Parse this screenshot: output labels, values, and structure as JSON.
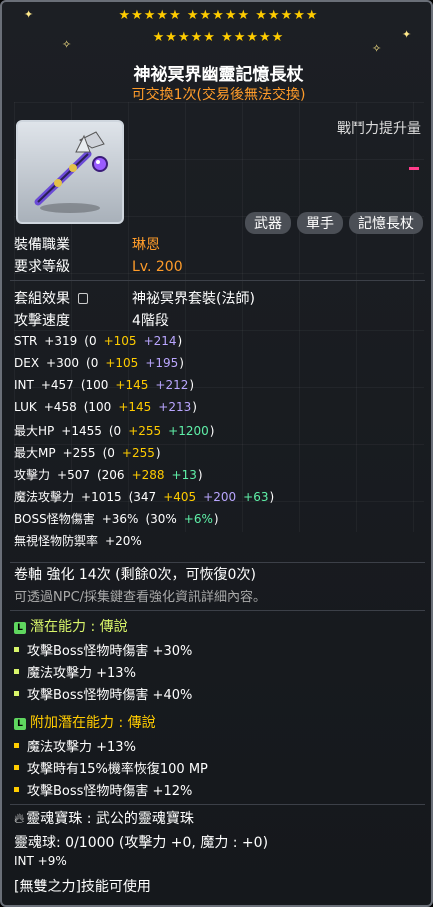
{
  "header": {
    "stars_row1": "★★★★★  ★★★★★  ★★★★★",
    "stars_row2": "★★★★★  ★★★★★",
    "title": "神祕冥界幽靈記憶長杖",
    "trade_note": "可交換1次(交易後無法交換)"
  },
  "item": {
    "icon": "staff-icon",
    "combat_power_label": "戰鬥力提升量",
    "tags": [
      "武器",
      "單手",
      "記憶長杖"
    ]
  },
  "requirements": [
    {
      "label": "裝備職業",
      "value": "琳恩"
    },
    {
      "label": "要求等級",
      "value": "Lv. 200"
    }
  ],
  "set": {
    "label": "套組效果",
    "value": "神祕冥界套裝(法師)"
  },
  "attack_speed": {
    "label": "攻擊速度",
    "value": "4階段"
  },
  "stats": [
    {
      "name": "STR",
      "total": "+319",
      "base": "(0",
      "star": "+105",
      "flame": "+214",
      "extra": "",
      "close": ")"
    },
    {
      "name": "DEX",
      "total": "+300",
      "base": "(0",
      "star": "+105",
      "flame": "+195",
      "extra": "",
      "close": ")"
    },
    {
      "name": "INT",
      "total": "+457",
      "base": "(100",
      "star": "+145",
      "flame": "+212",
      "extra": "",
      "close": ")"
    },
    {
      "name": "LUK",
      "total": "+458",
      "base": "(100",
      "star": "+145",
      "flame": "+213",
      "extra": "",
      "close": ")"
    },
    {
      "name": "最大HP",
      "total": "+1455",
      "base": "(0",
      "star": "+255",
      "flame": "",
      "extra": "+1200",
      "close": ")"
    },
    {
      "name": "最大MP",
      "total": "+255",
      "base": "(0",
      "star": "+255",
      "flame": "",
      "extra": "",
      "close": ")"
    },
    {
      "name": "攻擊力",
      "total": "+507",
      "base": "(206",
      "star": "+288",
      "flame": "",
      "extra": "+13",
      "close": ")"
    },
    {
      "name": "魔法攻擊力",
      "total": "+1015",
      "base": "(347",
      "star": "+405",
      "flame": "+200",
      "extra": "+63",
      "close": ")"
    },
    {
      "name": "BOSS怪物傷害",
      "total": "+36%",
      "base": "(30%",
      "star": "",
      "flame": "",
      "extra": "+6%",
      "close": ")"
    },
    {
      "name": "無視怪物防禦率",
      "total": "+20%",
      "base": "",
      "star": "",
      "flame": "",
      "extra": "",
      "close": ""
    }
  ],
  "scroll": {
    "line": "卷軸 強化 14次 (剩餘0次，可恢復0次)",
    "hint": "可透過NPC/採集鍵查看強化資訊詳細內容。"
  },
  "potential": {
    "title": "潛在能力 : 傳說",
    "badge": "L",
    "lines": [
      "攻擊Boss怪物時傷害 +30%",
      "魔法攻擊力 +13%",
      "攻擊Boss怪物時傷害 +40%"
    ]
  },
  "additional": {
    "title": "附加潛在能力 : 傳說",
    "badge": "L",
    "lines": [
      "魔法攻擊力 +13%",
      "攻擊時有15%機率恢復100 MP",
      "攻擊Boss怪物時傷害 +12%"
    ]
  },
  "soul": {
    "icon": "soul-flame-icon",
    "name_line": "靈魂寶珠 : 武公的靈魂寶珠",
    "charge_line": "靈魂球: 0/1000 (攻擊力 +0, 魔力 : +0)",
    "bonus": "INT +9%",
    "skill": "[無雙之力]技能可使用"
  },
  "colors": {
    "orange": "#ff9c2a",
    "yellow": "#ffcc00",
    "violet": "#b9a6ff",
    "green": "#5ff0a8",
    "legendary": "#5fd65f"
  }
}
